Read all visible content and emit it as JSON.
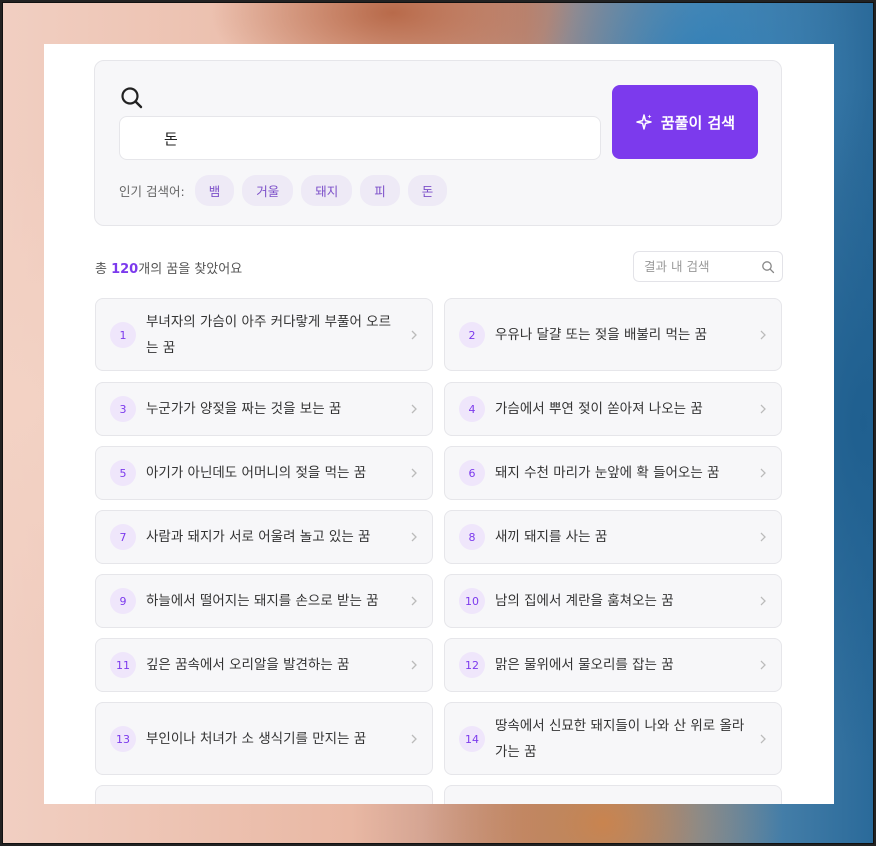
{
  "search": {
    "value": "돈",
    "button_label": "꿈풀이 검색"
  },
  "popular": {
    "label": "인기 검색어:",
    "tags": [
      "뱀",
      "거울",
      "돼지",
      "피",
      "돈"
    ]
  },
  "results": {
    "prefix": "총 ",
    "count": "120",
    "suffix": "개의 꿈을 찾았어요",
    "filter_placeholder": "결과 내 검색"
  },
  "items": [
    {
      "num": "1",
      "text": "부녀자의 가슴이 아주 커다랗게 부풀어 오르는 꿈"
    },
    {
      "num": "2",
      "text": "우유나 달걀 또는 젖을 배불리 먹는 꿈"
    },
    {
      "num": "3",
      "text": "누군가가 양젖을 짜는 것을 보는 꿈"
    },
    {
      "num": "4",
      "text": "가슴에서 뿌연 젖이 쏟아져 나오는 꿈"
    },
    {
      "num": "5",
      "text": "아기가 아닌데도 어머니의 젖을 먹는 꿈"
    },
    {
      "num": "6",
      "text": "돼지 수천 마리가 눈앞에 확 들어오는 꿈"
    },
    {
      "num": "7",
      "text": "사람과 돼지가 서로 어울려 놀고 있는 꿈"
    },
    {
      "num": "8",
      "text": "새끼 돼지를 사는 꿈"
    },
    {
      "num": "9",
      "text": "하늘에서 떨어지는 돼지를 손으로 받는 꿈"
    },
    {
      "num": "10",
      "text": "남의 집에서 계란을 훔쳐오는 꿈"
    },
    {
      "num": "11",
      "text": "깊은 꿈속에서 오리알을 발견하는 꿈"
    },
    {
      "num": "12",
      "text": "맑은 물위에서 물오리를 잡는 꿈"
    },
    {
      "num": "13",
      "text": "부인이나 처녀가 소 생식기를 만지는 꿈"
    },
    {
      "num": "14",
      "text": "땅속에서 신묘한 돼지들이 나와 산 위로 올라가는 꿈"
    }
  ],
  "colors": {
    "accent": "#7c3aed",
    "chip_bg": "#eeeaf6",
    "number_bg": "#efe6fb"
  }
}
